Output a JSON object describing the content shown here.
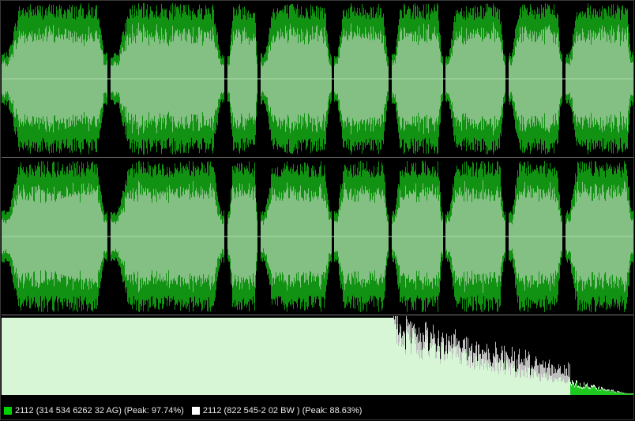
{
  "colors": {
    "background": "#000000",
    "waveform_peak": "#129212",
    "waveform_rms": "#84c084",
    "center_line": "#a8d8a8",
    "spectrum_fill": "#d6f6d6",
    "spectrum_overlay_green": "#1ec81e",
    "spectrum_overlay_white": "#ffffff",
    "legend_green": "#00d000",
    "legend_white": "#ffffff",
    "status_text": "#e8e8e8"
  },
  "waveform": {
    "channels": [
      "left",
      "right"
    ],
    "segment_starts": [
      0.0,
      0.172,
      0.357,
      0.41,
      0.526,
      0.617,
      0.703,
      0.802,
      0.892
    ],
    "segment_ends": [
      0.168,
      0.352,
      0.405,
      0.522,
      0.613,
      0.699,
      0.798,
      0.888,
      1.0
    ]
  },
  "spectrum": {
    "overlay_start": 0.62,
    "overlay_green_region": 0.9
  },
  "statusbar": {
    "legend_green_text": "2112 (314 534 6262 32 AG) (Peak: 97.74%)",
    "legend_white_text": "2112 (822 545-2 02 BW ) (Peak: 88.63%)"
  }
}
